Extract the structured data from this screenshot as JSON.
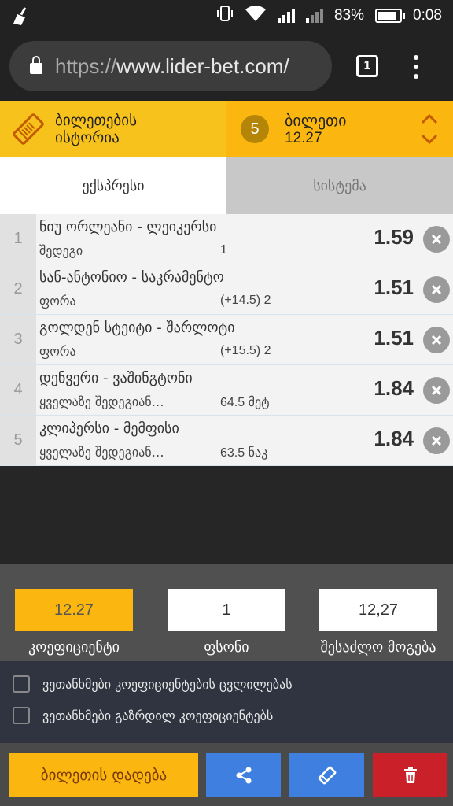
{
  "status_bar": {
    "battery_percent": "83%",
    "time": "0:08",
    "icons": [
      "broom-icon",
      "vibrate-icon",
      "wifi-icon",
      "signal-icon",
      "signal-weak-icon",
      "battery-icon"
    ]
  },
  "browser": {
    "url_proto": "https://",
    "url_host": "www.lider-bet.com/",
    "tab_count": "1"
  },
  "ticket_header": {
    "history_label_line1": "ბილეთების",
    "history_label_line2": "ისტორია",
    "ticket_count": "5",
    "ticket_label": "ბილეთი",
    "ticket_odds": "12.27"
  },
  "tabs": [
    {
      "label": "ექსპრესი",
      "active": true
    },
    {
      "label": "სისტემა",
      "active": false
    }
  ],
  "bets": [
    {
      "num": "1",
      "match": "ნიუ ორლეანი - ლეიკერსი",
      "market": "შედეგი",
      "selection": "1",
      "odds": "1.59"
    },
    {
      "num": "2",
      "match": "სან-ანტონიო - საკრამენტო",
      "market": "ფორა",
      "selection": "(+14.5) 2",
      "odds": "1.51"
    },
    {
      "num": "3",
      "match": "გოლდენ სტეიტი - შარლოტი",
      "market": "ფორა",
      "selection": "(+15.5) 2",
      "odds": "1.51"
    },
    {
      "num": "4",
      "match": "დენვერი - ვაშინგტონი",
      "market": "ყველაზე შედეგიან…",
      "selection": "64.5 მეტ",
      "odds": "1.84"
    },
    {
      "num": "5",
      "match": "კლიპერსი - მემფისი",
      "market": "ყველაზე შედეგიან…",
      "selection": "63.5 ნაკ",
      "odds": "1.84"
    }
  ],
  "stake_panel": {
    "coefficient_value": "12.27",
    "stake_value": "1",
    "possible_win_value": "12,27",
    "coefficient_label": "კოეფიციენტი",
    "stake_label": "ფსონი",
    "possible_win_label": "შესაძლო მოგება"
  },
  "checkboxes": [
    {
      "label": "ვეთანხმები კოეფიციენტების ცვლილებას",
      "checked": false
    },
    {
      "label": "ვეთანხმები გაზრდილ კოეფიციენტებს",
      "checked": false
    }
  ],
  "actions": {
    "place_bet_label": "ბილეთის დადება",
    "colors": {
      "primary": "#fbb70f",
      "blue": "#3f7fe0",
      "red": "#c9202a"
    }
  }
}
